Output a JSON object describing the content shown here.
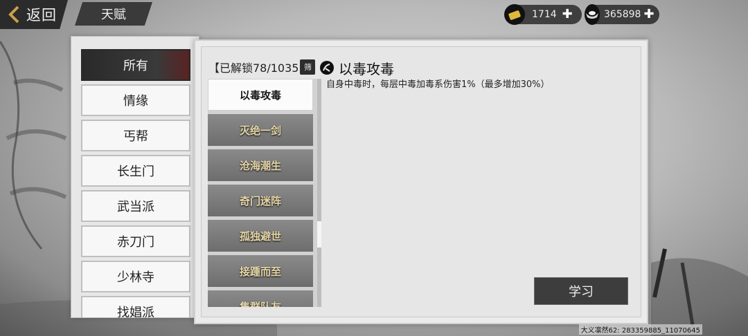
{
  "header": {
    "back_label": "返回",
    "page_tab": "天赋"
  },
  "currencies": [
    {
      "icon": "gold-ingot-icon",
      "value": "1714"
    },
    {
      "icon": "silver-ingot-icon",
      "value": "365898"
    }
  ],
  "categories": [
    "所有",
    "情缘",
    "丐帮",
    "长生门",
    "武当派",
    "赤刀门",
    "少林寺",
    "找娼派"
  ],
  "unlock": {
    "text": "【已解锁78/1035",
    "filter_label": "筛"
  },
  "selected_talent": {
    "name": "以毒攻毒",
    "description": "自身中毒时，每层中毒加毒系伤害1%（最多增加30%）"
  },
  "talents": [
    "以毒攻毒",
    "灭绝一剑",
    "沧海潮生",
    "奇门迷阵",
    "孤独避世",
    "接踵而至",
    "集群队友"
  ],
  "learn_label": "学习",
  "footer_text": "大义凛然62: 283359885_11070645"
}
